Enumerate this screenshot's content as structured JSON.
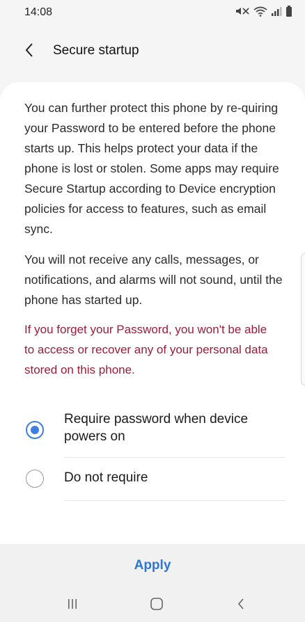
{
  "status_bar": {
    "time": "14:08",
    "icons": [
      "mute-icon",
      "wifi-icon",
      "signal-icon",
      "battery-icon"
    ]
  },
  "header": {
    "title": "Secure startup",
    "back_icon": "chevron-left-icon"
  },
  "content": {
    "description": "You can further protect this phone by re-quiring your Password to be entered before the phone starts up. This helps protect your data if the phone is lost or stolen. Some apps may require Secure Startup according to Device encryption policies for access to features, such as email sync.",
    "notice": "You will not receive any calls, messages, or notifications, and alarms will not sound, until the phone has started up.",
    "warning": "If you forget your Password, you won't be able to access or recover any of your personal data stored on this phone."
  },
  "options": [
    {
      "label": "Require password when device powers on",
      "selected": true
    },
    {
      "label": "Do not require",
      "selected": false
    }
  ],
  "footer": {
    "apply_label": "Apply"
  },
  "navigation": {
    "recents_icon": "recents-icon",
    "home_icon": "home-icon",
    "back_icon": "back-icon"
  },
  "colors": {
    "accent": "#3e7ee0",
    "warning": "#9b1c3a",
    "apply": "#2d76d3",
    "background": "#f5f5f5"
  }
}
